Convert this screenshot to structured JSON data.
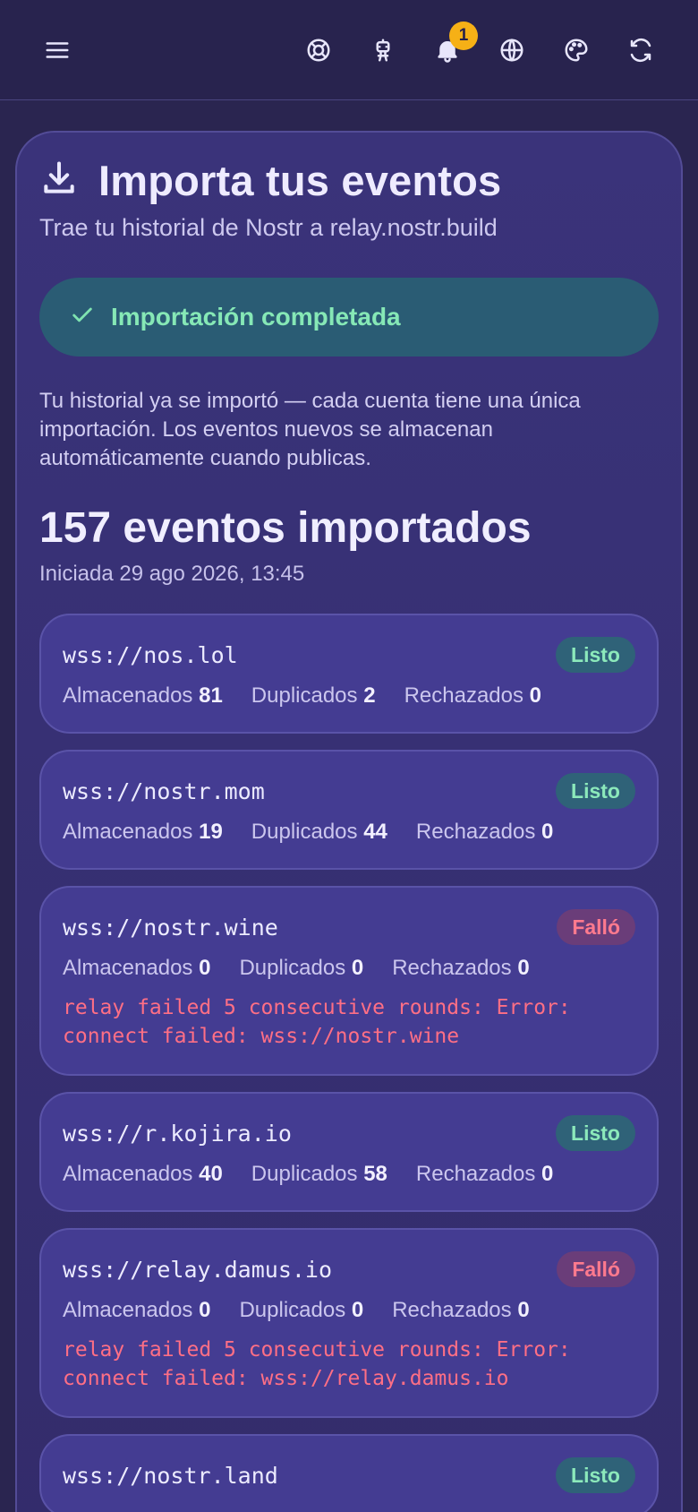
{
  "topbar": {
    "icons": [
      "menu-icon",
      "help-lifebuoy-icon",
      "robot-icon",
      "bell-icon",
      "globe-icon",
      "palette-icon",
      "refresh-icon"
    ],
    "notification_count": "1"
  },
  "main": {
    "title": "Importa tus eventos",
    "subtitle": "Trae tu historial de Nostr a relay.nostr.build",
    "success_message": "Importación completada",
    "description": "Tu historial ya se importó — cada cuenta tiene una única importación. Los eventos nuevos se almacenan automáticamente cuando publicas.",
    "events_count": "157 eventos importados",
    "started": "Iniciada 29 ago 2026, 13:45"
  },
  "labels": {
    "stored": "Almacenados",
    "duplicated": "Duplicados",
    "rejected": "Rechazados"
  },
  "relays": [
    {
      "url": "wss://nos.lol",
      "status": "Listo",
      "state": "ok",
      "stored": "81",
      "duplicated": "2",
      "rejected": "0",
      "error": ""
    },
    {
      "url": "wss://nostr.mom",
      "status": "Listo",
      "state": "ok",
      "stored": "19",
      "duplicated": "44",
      "rejected": "0",
      "error": ""
    },
    {
      "url": "wss://nostr.wine",
      "status": "Falló",
      "state": "fail",
      "stored": "0",
      "duplicated": "0",
      "rejected": "0",
      "error": "relay failed 5 consecutive rounds: Error: connect failed: wss://nostr.wine"
    },
    {
      "url": "wss://r.kojira.io",
      "status": "Listo",
      "state": "ok",
      "stored": "40",
      "duplicated": "58",
      "rejected": "0",
      "error": ""
    },
    {
      "url": "wss://relay.damus.io",
      "status": "Falló",
      "state": "fail",
      "stored": "0",
      "duplicated": "0",
      "rejected": "0",
      "error": "relay failed 5 consecutive rounds: Error: connect failed: wss://relay.damus.io"
    },
    {
      "url": "wss://nostr.land",
      "status": "Listo",
      "state": "ok",
      "stored": "",
      "duplicated": "",
      "rejected": "",
      "error": ""
    }
  ],
  "colors": {
    "background": "#2a2550",
    "card": "#3a337a",
    "relay_card": "#443c92",
    "success_bg": "#2a5c74",
    "success_text": "#86e8b6",
    "fail_text": "#ff6f85",
    "badge": "#f6b016"
  }
}
